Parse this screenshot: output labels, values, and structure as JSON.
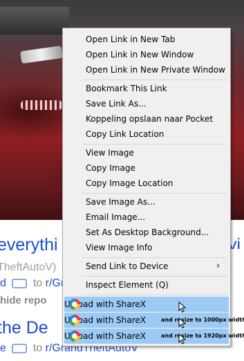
{
  "background": {
    "title_1_left": "everythi",
    "title_1_right": "yi",
    "subreddit_1": "TheftAutoV)",
    "meta_1_prefix": "d",
    "meta_1_to": "to",
    "meta_1_sub": "r/Grand",
    "actions_1": "hide   repo",
    "title_2": "the De",
    "meta_2_prefix": "e",
    "meta_2_to": "to",
    "meta_2_sub": "r/GrandTheftAutoV"
  },
  "menu": {
    "items": [
      {
        "label": "Open Link in New Tab"
      },
      {
        "label": "Open Link in New Window"
      },
      {
        "label": "Open Link in New Private Window"
      },
      {
        "label": "Bookmark This Link"
      },
      {
        "label": "Save Link As..."
      },
      {
        "label": "Koppeling opslaan naar Pocket"
      },
      {
        "label": "Copy Link Location"
      },
      {
        "label": "View Image"
      },
      {
        "label": "Copy Image"
      },
      {
        "label": "Copy Image Location"
      },
      {
        "label": "Save Image As..."
      },
      {
        "label": "Email Image..."
      },
      {
        "label": "Set As Desktop Background..."
      },
      {
        "label": "View Image Info"
      },
      {
        "label": "Send Link to Device"
      },
      {
        "label": "Inspect Element (Q)"
      }
    ],
    "submenu_arrow": "›",
    "sharex": [
      {
        "label": "Upload with ShareX",
        "suffix": ""
      },
      {
        "label": "Upload with ShareX",
        "suffix": "and resize to 1000px width"
      },
      {
        "label": "Upload with ShareX",
        "suffix": "and resize to 1920px width"
      }
    ]
  }
}
